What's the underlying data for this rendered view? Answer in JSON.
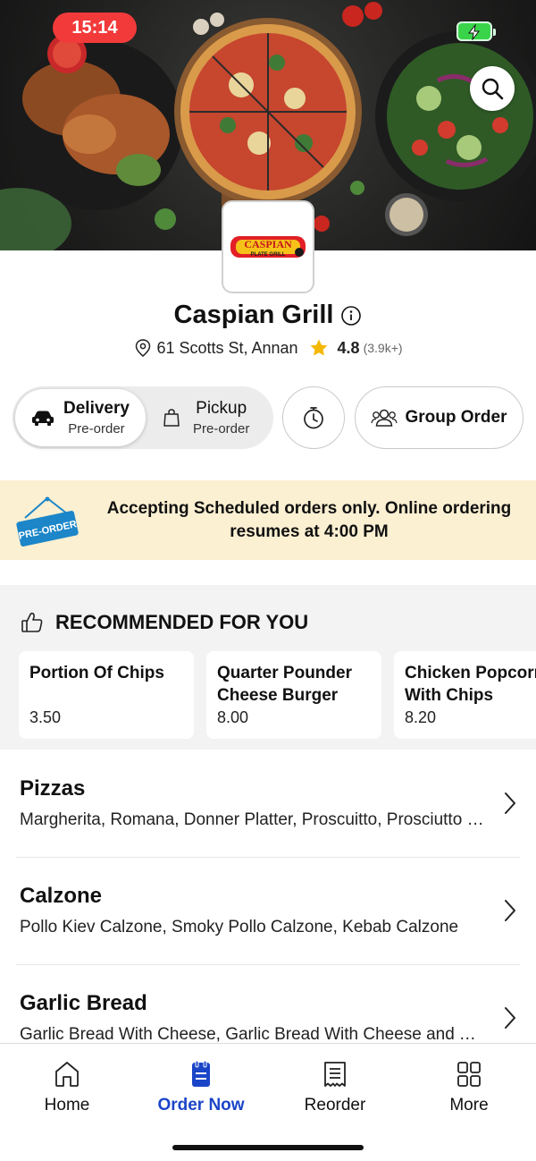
{
  "status_bar": {
    "time": "15:14"
  },
  "restaurant": {
    "name": "Caspian Grill",
    "address": "61 Scotts St, Annan",
    "rating": "4.8",
    "rating_count": "(3.9k+)",
    "logo_text": "CASPIAN",
    "logo_subtext": "PLATE GRILL"
  },
  "order_mode": {
    "delivery": {
      "label": "Delivery",
      "sub": "Pre-order",
      "selected": true
    },
    "pickup": {
      "label": "Pickup",
      "sub": "Pre-order",
      "selected": false
    },
    "group_order_label": "Group Order"
  },
  "banner": {
    "sign_text": "PRE-ORDER",
    "message": "Accepting Scheduled orders only. Online ordering resumes at 4:00 PM"
  },
  "recommended": {
    "heading": "RECOMMENDED FOR YOU",
    "items": [
      {
        "name": "Portion Of Chips",
        "price": "3.50"
      },
      {
        "name": "Quarter Pounder\nCheese Burger",
        "price": "8.00"
      },
      {
        "name": "Chicken Popcorn\nWith Chips",
        "price": "8.20"
      }
    ]
  },
  "categories": [
    {
      "title": "Pizzas",
      "desc": "Margherita, Romana, Donner Platter, Proscuitto, Prosciutto Funghi"
    },
    {
      "title": "Calzone",
      "desc": "Pollo Kiev Calzone, Smoky Pollo Calzone, Kebab Calzone"
    },
    {
      "title": "Garlic Bread",
      "desc": "Garlic Bread With Cheese, Garlic Bread With Cheese and Tomato"
    }
  ],
  "tabbar": {
    "items": [
      {
        "label": "Home",
        "icon": "home-icon"
      },
      {
        "label": "Order Now",
        "icon": "order-icon",
        "active": true
      },
      {
        "label": "Reorder",
        "icon": "receipt-icon"
      },
      {
        "label": "More",
        "icon": "grid-icon"
      }
    ]
  },
  "colors": {
    "accent": "#1b45c8",
    "banner_bg": "#fbf0d2",
    "status_red": "#f23a3a",
    "star": "#f5b800",
    "preorder_sign": "#1c86c8"
  }
}
